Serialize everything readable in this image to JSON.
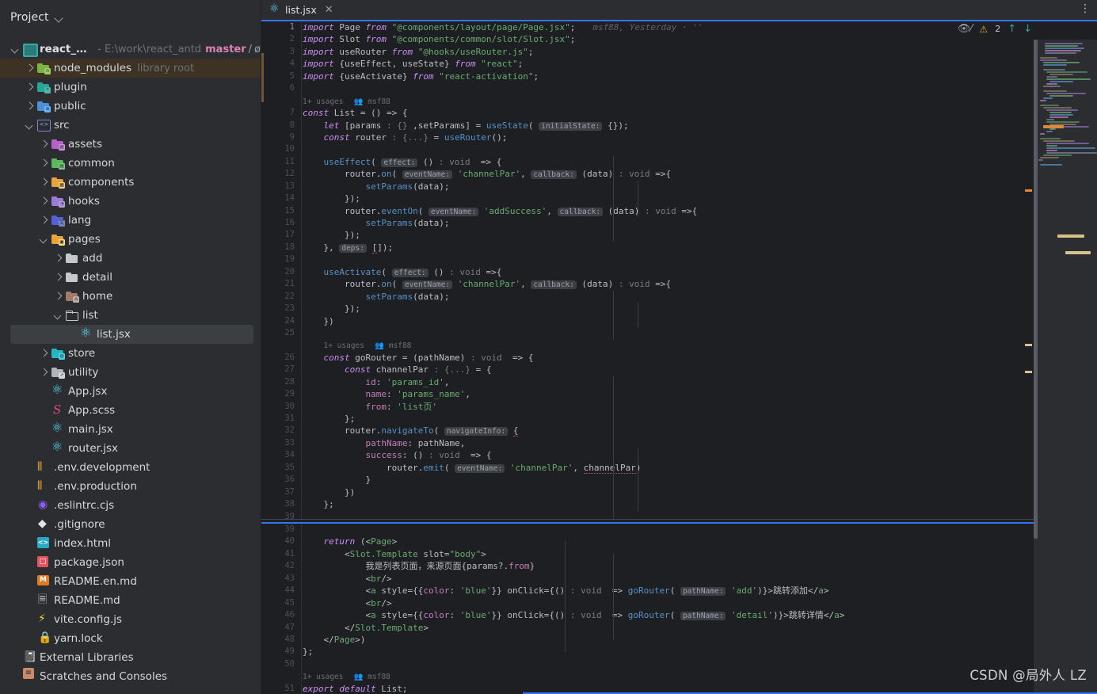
{
  "project_panel": {
    "header_label": "Project",
    "header_chevron_icon": "chevron-down-icon",
    "root": {
      "name": "react_antd",
      "dash": "-",
      "path": "E:\\work\\react_antd",
      "branch": "master",
      "slash": "/",
      "nolink": "ø"
    },
    "items": [
      {
        "label": "node_modules",
        "sub": "library root",
        "indent": 1,
        "state": "closed",
        "icon": "folder-node-modules-icon",
        "highlight": "brown"
      },
      {
        "label": "plugin",
        "sub": "",
        "indent": 1,
        "state": "closed",
        "icon": "folder-plugin-icon",
        "highlight": ""
      },
      {
        "label": "public",
        "sub": "",
        "indent": 1,
        "state": "closed",
        "icon": "folder-public-icon",
        "highlight": ""
      },
      {
        "label": "src",
        "sub": "",
        "indent": 1,
        "state": "open",
        "icon": "folder-source-icon",
        "highlight": ""
      },
      {
        "label": "assets",
        "sub": "",
        "indent": 2,
        "state": "closed",
        "icon": "folder-assets-icon",
        "highlight": ""
      },
      {
        "label": "common",
        "sub": "",
        "indent": 2,
        "state": "closed",
        "icon": "folder-common-icon",
        "highlight": ""
      },
      {
        "label": "components",
        "sub": "",
        "indent": 2,
        "state": "closed",
        "icon": "folder-components-icon",
        "highlight": ""
      },
      {
        "label": "hooks",
        "sub": "",
        "indent": 2,
        "state": "closed",
        "icon": "folder-hooks-icon",
        "highlight": ""
      },
      {
        "label": "lang",
        "sub": "",
        "indent": 2,
        "state": "closed",
        "icon": "folder-lang-icon",
        "highlight": ""
      },
      {
        "label": "pages",
        "sub": "",
        "indent": 2,
        "state": "open",
        "icon": "folder-pages-icon",
        "highlight": ""
      },
      {
        "label": "add",
        "sub": "",
        "indent": 3,
        "state": "closed",
        "icon": "folder-plain-icon",
        "highlight": ""
      },
      {
        "label": "detail",
        "sub": "",
        "indent": 3,
        "state": "closed",
        "icon": "folder-plain-icon",
        "highlight": ""
      },
      {
        "label": "home",
        "sub": "",
        "indent": 3,
        "state": "closed",
        "icon": "folder-home-icon",
        "highlight": ""
      },
      {
        "label": "list",
        "sub": "",
        "indent": 3,
        "state": "open",
        "icon": "folder-outline-icon",
        "highlight": ""
      },
      {
        "label": "list.jsx",
        "sub": "",
        "indent": 4,
        "state": "leaf",
        "icon": "react-file-icon",
        "highlight": "selected"
      },
      {
        "label": "store",
        "sub": "",
        "indent": 2,
        "state": "closed",
        "icon": "folder-store-icon",
        "highlight": ""
      },
      {
        "label": "utility",
        "sub": "",
        "indent": 2,
        "state": "closed",
        "icon": "folder-utility-icon",
        "highlight": ""
      },
      {
        "label": "App.jsx",
        "sub": "",
        "indent": 2,
        "state": "leaf",
        "icon": "react-file-icon",
        "highlight": ""
      },
      {
        "label": "App.scss",
        "sub": "",
        "indent": 2,
        "state": "leaf",
        "icon": "scss-file-icon",
        "highlight": ""
      },
      {
        "label": "main.jsx",
        "sub": "",
        "indent": 2,
        "state": "leaf",
        "icon": "react-file-icon",
        "highlight": ""
      },
      {
        "label": "router.jsx",
        "sub": "",
        "indent": 2,
        "state": "leaf",
        "icon": "react-file-icon",
        "highlight": ""
      },
      {
        "label": ".env.development",
        "sub": "",
        "indent": 1,
        "state": "leaf",
        "icon": "env-file-icon",
        "highlight": ""
      },
      {
        "label": ".env.production",
        "sub": "",
        "indent": 1,
        "state": "leaf",
        "icon": "env-file-icon",
        "highlight": ""
      },
      {
        "label": ".eslintrc.cjs",
        "sub": "",
        "indent": 1,
        "state": "leaf",
        "icon": "eslint-file-icon",
        "highlight": ""
      },
      {
        "label": ".gitignore",
        "sub": "",
        "indent": 1,
        "state": "leaf",
        "icon": "gitignore-file-icon",
        "highlight": ""
      },
      {
        "label": "index.html",
        "sub": "",
        "indent": 1,
        "state": "leaf",
        "icon": "html-file-icon",
        "highlight": ""
      },
      {
        "label": "package.json",
        "sub": "",
        "indent": 1,
        "state": "leaf",
        "icon": "json-file-icon",
        "highlight": ""
      },
      {
        "label": "README.en.md",
        "sub": "",
        "indent": 1,
        "state": "leaf",
        "icon": "markdown-en-file-icon",
        "highlight": ""
      },
      {
        "label": "README.md",
        "sub": "",
        "indent": 1,
        "state": "leaf",
        "icon": "markdown-file-icon",
        "highlight": ""
      },
      {
        "label": "vite.config.js",
        "sub": "",
        "indent": 1,
        "state": "leaf",
        "icon": "vite-file-icon",
        "highlight": ""
      },
      {
        "label": "yarn.lock",
        "sub": "",
        "indent": 1,
        "state": "leaf",
        "icon": "lock-file-icon",
        "highlight": ""
      },
      {
        "label": "External Libraries",
        "sub": "",
        "indent": 0,
        "state": "leaf",
        "icon": "external-libraries-icon",
        "highlight": ""
      },
      {
        "label": "Scratches and Consoles",
        "sub": "",
        "indent": 0,
        "state": "leaf",
        "icon": "scratches-icon",
        "highlight": ""
      }
    ]
  },
  "editor": {
    "tab": {
      "label": "list.jsx",
      "icon": "react-file-icon",
      "close_icon": "close-icon"
    },
    "tab_menu_icon": "more-vertical-icon",
    "inspector": {
      "eye_icon": "inspection-eye-icon",
      "warning_icon": "warning-triangle-icon",
      "warning_count": "2",
      "prev_icon": "arrow-up-icon",
      "next_icon": "arrow-down-icon"
    },
    "blame_annotation": "msf88, Yesterday · ''",
    "top_pane": {
      "first_line": 1,
      "lines": [
        {
          "n": 1,
          "html": "<span class=\"k\">import</span> <span class=\"id\">Page</span> <span class=\"k\">from</span> <span class=\"str\">\"@components/layout/page/Page.jsx\"</span>;"
        },
        {
          "n": 2,
          "html": "<span class=\"k\">import</span> <span class=\"id\">Slot</span> <span class=\"k\">from</span> <span class=\"str\">\"@components/common/slot/Slot.jsx\"</span>;"
        },
        {
          "n": 3,
          "html": "<span class=\"k\">import</span> <span class=\"id\">useRouter</span> <span class=\"k\">from</span> <span class=\"str\">\"@hooks/useRouter.js\"</span>;"
        },
        {
          "n": 4,
          "html": "<span class=\"k\">import</span> {<span class=\"id\">useEffect</span>, <span class=\"id\">useState</span>} <span class=\"k\">from</span> <span class=\"str\">\"react\"</span>;"
        },
        {
          "n": 5,
          "html": "<span class=\"k\">import</span> {<span class=\"id\">useActivate</span>} <span class=\"k\">from</span> <span class=\"str\">\"react-activation\"</span>;"
        },
        {
          "n": 6,
          "html": ""
        },
        {
          "n": 0,
          "html": "<span class=\"usages\">1+ usages</span>&nbsp;&nbsp;<span class=\"author\">&#128101; msf88</span>"
        },
        {
          "n": 7,
          "html": "<span class=\"k\">const</span> <span class=\"id\">List</span> = () =&gt; {"
        },
        {
          "n": 8,
          "html": "    <span class=\"k\">let</span> [<span class=\"id\">params</span> <span class=\"hint\">: {}</span> ,<span class=\"id\">setParams</span>] = <span class=\"fn\">useState</span>( <span class=\"inlay\">initialState:</span> {});"
        },
        {
          "n": 9,
          "html": "    <span class=\"k\">const</span> <span class=\"id\">router</span> <span class=\"hint\">: {...}</span> = <span class=\"fn\">useRouter</span>();"
        },
        {
          "n": 10,
          "html": ""
        },
        {
          "n": 11,
          "html": "    <span class=\"fn\">useEffect</span>( <span class=\"inlay\">effect:</span> () <span class=\"hint\">: void</span>  =&gt; {"
        },
        {
          "n": 12,
          "html": "        <span class=\"id\">router</span>.<span class=\"fn\">on</span>( <span class=\"inlay\">eventName:</span> <span class=\"str\">'channelPar'</span>, <span class=\"inlay\">callback:</span> (<span class=\"id\">data</span>) <span class=\"hint\">: void</span> =&gt;{"
        },
        {
          "n": 13,
          "html": "            <span class=\"fn\">setParams</span>(<span class=\"id\">data</span>);"
        },
        {
          "n": 14,
          "html": "        });"
        },
        {
          "n": 15,
          "html": "        <span class=\"id\">router</span>.<span class=\"fn\">eventOn</span>( <span class=\"inlay\">eventName:</span> <span class=\"str\">'addSuccess'</span>, <span class=\"inlay\">callback:</span> (<span class=\"id\">data</span>) <span class=\"hint\">: void</span> =&gt;{"
        },
        {
          "n": 16,
          "html": "            <span class=\"fn\">setParams</span>(<span class=\"id\">data</span>);"
        },
        {
          "n": 17,
          "html": "        });"
        },
        {
          "n": 18,
          "html": "    }, <span class=\"inlay\">deps:</span> <span class=\"err-u\">[</span>]);"
        },
        {
          "n": 19,
          "html": ""
        },
        {
          "n": 20,
          "html": "    <span class=\"fn\">useActivate</span>( <span class=\"inlay\">effect:</span> () <span class=\"hint\">: void</span> =&gt;{"
        },
        {
          "n": 21,
          "html": "        <span class=\"id\">router</span>.<span class=\"fn\">on</span>( <span class=\"inlay\">eventName:</span> <span class=\"str\">'channelPar'</span>, <span class=\"inlay\">callback:</span> (<span class=\"id\">data</span>) <span class=\"hint\">: void</span> =&gt;{"
        },
        {
          "n": 22,
          "html": "            <span class=\"fn\">setParams</span>(<span class=\"id\">data</span>);"
        },
        {
          "n": 23,
          "html": "        });"
        },
        {
          "n": 24,
          "html": "    })"
        },
        {
          "n": 25,
          "html": ""
        },
        {
          "n": 0,
          "html": "    <span class=\"usages\">1+ usages</span>&nbsp;&nbsp;<span class=\"author\">&#128101; msf88</span>"
        },
        {
          "n": 26,
          "html": "    <span class=\"k\">const</span> <span class=\"id\">goRouter</span> = (<span class=\"id\">pathName</span>) <span class=\"hint\">: void</span>  =&gt; {"
        },
        {
          "n": 27,
          "html": "        <span class=\"k\">const</span> <span class=\"id\">channelPar</span> <span class=\"hint\">: {...}</span> = {"
        },
        {
          "n": 28,
          "html": "            <span class=\"prop\">id</span>: <span class=\"str\">'params_id'</span>,"
        },
        {
          "n": 29,
          "html": "            <span class=\"prop\">name</span>: <span class=\"str\">'params_name'</span>,"
        },
        {
          "n": 30,
          "html": "            <span class=\"prop\">from</span>: <span class=\"str\">'list&#39029;'</span>"
        },
        {
          "n": 31,
          "html": "        };"
        },
        {
          "n": 32,
          "html": "        <span class=\"id\">router</span>.<span class=\"fn\">navigateTo</span>( <span class=\"inlay\">navigateInfo:</span> <span class=\"err-u\">{</span>"
        },
        {
          "n": 33,
          "html": "            <span class=\"prop\">pathName</span>: <span class=\"id\">pathName</span>,"
        },
        {
          "n": 34,
          "html": "            <span class=\"prop\">success</span>: () <span class=\"hint\">: void</span>  =&gt; {"
        },
        {
          "n": 35,
          "html": "                <span class=\"id\">router</span>.<span class=\"fn\">emit</span>( <span class=\"inlay\">eventName:</span> <span class=\"str\">'channelPar'</span>, <span class=\"err-u\">channelPar</span>)"
        },
        {
          "n": 36,
          "html": "            }"
        },
        {
          "n": 37,
          "html": "        })"
        },
        {
          "n": 38,
          "html": "    };"
        },
        {
          "n": 39,
          "html": ""
        }
      ]
    },
    "bottom_pane": {
      "lines": [
        {
          "n": 39,
          "html": ""
        },
        {
          "n": 40,
          "html": "    <span class=\"k\">return</span> (&lt;<span class=\"tag\">Page</span>&gt;"
        },
        {
          "n": 41,
          "html": "        &lt;<span class=\"tag\">Slot.Template</span> <span class=\"attr\">slot</span>=<span class=\"str\">\"body\"</span>&gt;"
        },
        {
          "n": 42,
          "html": "            <span class=\"cn\">&#25105;&#26159;&#21015;&#34920;&#39029;&#38754;&#65292;&#26469;&#28304;&#39029;&#38754;</span>{<span class=\"id\">params</span>?.<span class=\"prop\">from</span>}"
        },
        {
          "n": 43,
          "html": "            &lt;<span class=\"tag\">br</span>/&gt;"
        },
        {
          "n": 44,
          "html": "            &lt;<span class=\"tag\">a</span> <span class=\"attr\">style</span>={{<span class=\"prop\">color</span>: <span class=\"str\">'blue'</span>}} <span class=\"attr\">onClick</span>={() <span class=\"hint\">: void</span>  =&gt; <span class=\"fn\">goRouter</span>( <span class=\"inlay\">pathName:</span> <span class=\"str\">'add'</span>)}&gt;<span class=\"cn\">&#36339;&#36716;&#28155;&#21152;</span>&lt;/<span class=\"tag\">a</span>&gt;"
        },
        {
          "n": 45,
          "html": "            &lt;<span class=\"tag\">br</span>/&gt;"
        },
        {
          "n": 46,
          "html": "            &lt;<span class=\"tag\">a</span> <span class=\"attr\">style</span>={{<span class=\"prop\">color</span>: <span class=\"str\">'blue'</span>}} <span class=\"attr\">onClick</span>={() <span class=\"hint\">: void</span>  =&gt; <span class=\"fn\">goRouter</span>( <span class=\"inlay\">pathName:</span> <span class=\"str\">'detail'</span>)}&gt;<span class=\"cn\">&#36339;&#36716;&#35814;&#24773;</span>&lt;/<span class=\"tag\">a</span>&gt;"
        },
        {
          "n": 47,
          "html": "        &lt;/<span class=\"tag\">Slot.Template</span>&gt;"
        },
        {
          "n": 48,
          "html": "    &lt;/<span class=\"tag\">Page</span>&gt;)"
        },
        {
          "n": 49,
          "html": "};"
        },
        {
          "n": 50,
          "html": ""
        },
        {
          "n": 0,
          "html": "<span class=\"usages\">1+ usages</span>&nbsp;&nbsp;<span class=\"author\">&#128101; msf88</span>"
        },
        {
          "n": 51,
          "html": "<span class=\"k\">export</span> <span class=\"k\">default</span> <span class=\"id\">List</span>;"
        }
      ]
    }
  },
  "watermark": {
    "text": "CSDN @局外人 LZ"
  },
  "colors": {
    "accent": "#3574f0",
    "panel_bg": "#2b2d30",
    "editor_bg": "#1e1f22",
    "warning": "#f0a732",
    "string": "#6aab73",
    "keyword": "#cf8ef5",
    "function": "#5791c8",
    "selected_row": "#3c3f41",
    "highlight_row": "#3d3223"
  }
}
